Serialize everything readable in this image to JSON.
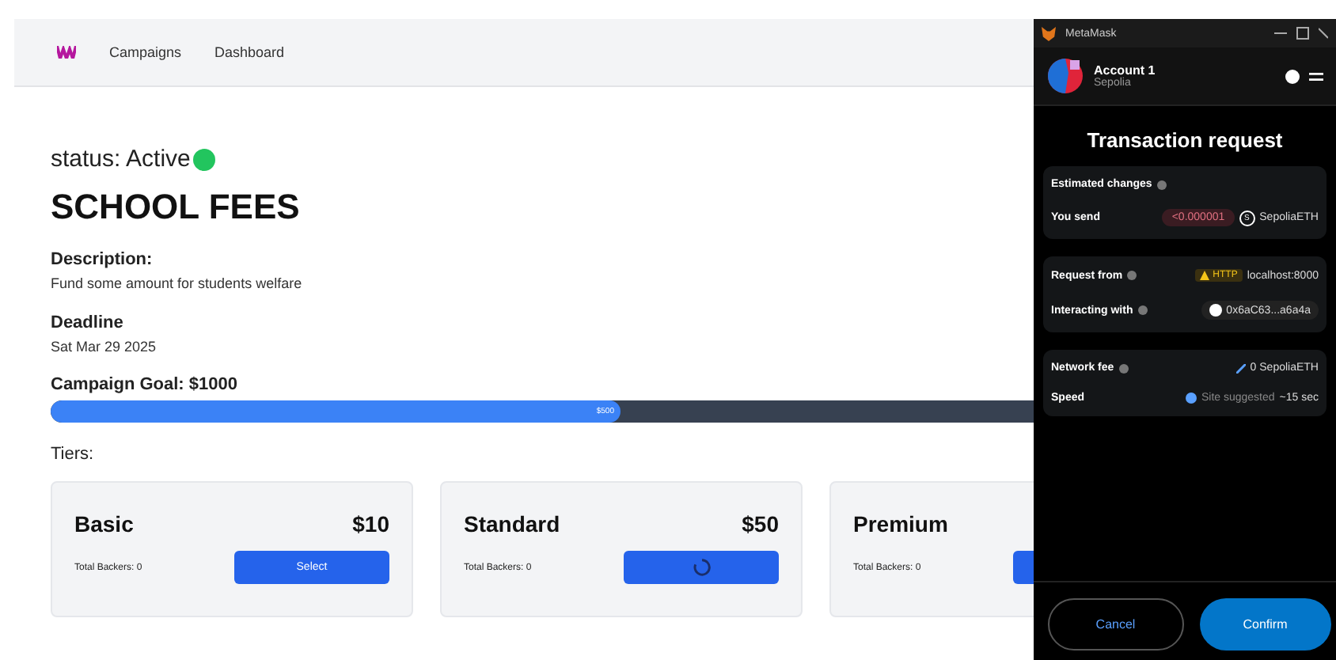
{
  "nav": {
    "links": [
      {
        "label": "Campaigns"
      },
      {
        "label": "Dashboard"
      }
    ]
  },
  "campaign": {
    "status_label": "status: Active",
    "active": true,
    "title": "SCHOOL FEES",
    "description_label": "Description:",
    "description": "Fund some amount for students welfare",
    "deadline_label": "Deadline",
    "deadline": "Sat Mar 29 2025",
    "goal_label": "Campaign Goal: $1000",
    "progress": {
      "level": 0.5,
      "label": "$500"
    }
  },
  "tiers_label": "Tiers:",
  "tiers": [
    {
      "name": "Basic",
      "price": "$10",
      "backers": "Total Backers: 0",
      "button": "Select",
      "loading": false
    },
    {
      "name": "Standard",
      "price": "$50",
      "backers": "Total Backers: 0",
      "loading": true
    },
    {
      "name": "Premium",
      "backers": "Total Backers: 0"
    }
  ],
  "wallet": {
    "window_title": "MetaMask",
    "account": "Account 1",
    "network": "Sepolia",
    "heading": "Transaction request",
    "sections": [
      {
        "rows": [
          {
            "kind": "header",
            "label": "Estimated changes"
          },
          {
            "kind": "send",
            "label": "You send",
            "amount": "<0.000001",
            "token_mark": "S",
            "token": "SepoliaETH"
          }
        ]
      },
      {
        "rows": [
          {
            "kind": "origin",
            "label": "Request from",
            "badge": "HTTP",
            "value": "localhost:8000"
          },
          {
            "kind": "address",
            "label": "Interacting with",
            "value": "0x6aC63...a6a4a"
          }
        ]
      },
      {
        "rows": [
          {
            "kind": "fee",
            "label": "Network fee",
            "value": "0 SepoliaETH"
          },
          {
            "kind": "speed",
            "label": "Speed",
            "value": "Site suggested",
            "extra": "~15 sec"
          }
        ]
      }
    ],
    "cancel": "Cancel",
    "confirm": "Confirm"
  }
}
